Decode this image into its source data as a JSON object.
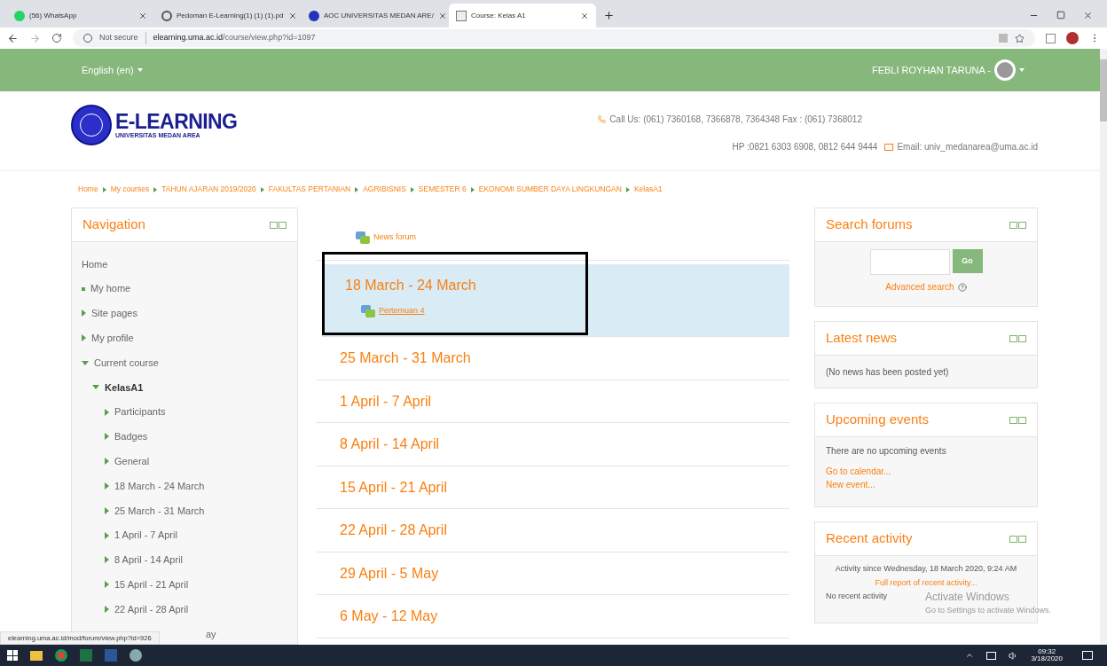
{
  "browser": {
    "tabs": [
      {
        "title": "(56) WhatsApp",
        "kind": "chat",
        "selected": false
      },
      {
        "title": "Pedoman E-Learning(1) (1) (1).pd",
        "kind": "globe",
        "selected": false
      },
      {
        "title": "AOC UNIVERSITAS MEDAN ARE/",
        "kind": "site",
        "selected": false
      },
      {
        "title": "Course: Kelas A1",
        "kind": "page",
        "selected": true
      }
    ],
    "security": "Not secure",
    "url_host": "elearning.uma.ac.id",
    "url_path": "/course/view.php?id=1097"
  },
  "topbar": {
    "language": "English (en)",
    "user": "FEBLI ROYHAN TARUNA -"
  },
  "logo": {
    "title": "E-LEARNING",
    "subtitle": "UNIVERSITAS MEDAN AREA"
  },
  "contact": {
    "phone": "Call Us: (061) 7360168, 7366878, 7364348 Fax : (061) 7368012",
    "mobile": "HP :0821 6303 6908, 0812 644 9444",
    "email": "Email: univ_medanarea@uma.ac.id"
  },
  "breadcrumb": [
    "Home",
    "My courses",
    "TAHUN AJARAN 2019/2020",
    "FAKULTAS PERTANIAN",
    "AGRIBISNIS",
    "SEMESTER 6",
    "EKONOMI SUMBER DAYA LINGKUNGAN",
    "KelasA1"
  ],
  "navigation": {
    "title": "Navigation",
    "items": [
      {
        "label": "Home",
        "kind": "plain"
      },
      {
        "label": "My home",
        "kind": "leaf"
      },
      {
        "label": "Site pages",
        "kind": "branch",
        "expanded": false
      },
      {
        "label": "My profile",
        "kind": "branch",
        "expanded": false
      },
      {
        "label": "Current course",
        "kind": "branch",
        "expanded": true,
        "children": [
          {
            "label": "KelasA1",
            "kind": "branch",
            "expanded": true,
            "active": true,
            "children": [
              {
                "label": "Participants",
                "kind": "branch",
                "expanded": false
              },
              {
                "label": "Badges",
                "kind": "branch",
                "expanded": false
              },
              {
                "label": "General",
                "kind": "branch",
                "expanded": false
              },
              {
                "label": "18 March - 24 March",
                "kind": "branch",
                "expanded": false
              },
              {
                "label": "25 March - 31 March",
                "kind": "branch",
                "expanded": false
              },
              {
                "label": "1 April - 7 April",
                "kind": "branch",
                "expanded": false
              },
              {
                "label": "8 April - 14 April",
                "kind": "branch",
                "expanded": false
              },
              {
                "label": "15 April - 21 April",
                "kind": "branch",
                "expanded": false
              },
              {
                "label": "22 April - 28 April",
                "kind": "branch",
                "expanded": false
              },
              {
                "label": "ay",
                "kind": "partial"
              }
            ]
          }
        ]
      }
    ]
  },
  "course": {
    "news_forum": "News forum",
    "sections": [
      {
        "title": "18 March - 24 March",
        "current": true,
        "activities": [
          "Pertemuan 4"
        ]
      },
      {
        "title": "25 March - 31 March",
        "current": false
      },
      {
        "title": "1 April - 7 April",
        "current": false
      },
      {
        "title": "8 April - 14 April",
        "current": false
      },
      {
        "title": "15 April - 21 April",
        "current": false
      },
      {
        "title": "22 April - 28 April",
        "current": false
      },
      {
        "title": "29 April - 5 May",
        "current": false
      },
      {
        "title": "6 May - 12 May",
        "current": false
      }
    ]
  },
  "blocks": {
    "search_forums": {
      "title": "Search forums",
      "button": "Go",
      "link": "Advanced search"
    },
    "latest_news": {
      "title": "Latest news",
      "text": "(No news has been posted yet)"
    },
    "upcoming_events": {
      "title": "Upcoming events",
      "text": "There are no upcoming events",
      "links": [
        "Go to calendar...",
        "New event..."
      ]
    },
    "recent_activity": {
      "title": "Recent activity",
      "since": "Activity since Wednesday, 18 March 2020, 9:24 AM",
      "link": "Full report of recent activity...",
      "text": "No recent activity"
    }
  },
  "status_url": "elearning.uma.ac.id/mod/forum/view.php?id=926",
  "windows_notice": {
    "title": "Activate Windows",
    "text": "Go to Settings to activate Windows."
  },
  "taskbar": {
    "time": "09:32",
    "date": "3/18/2020"
  }
}
